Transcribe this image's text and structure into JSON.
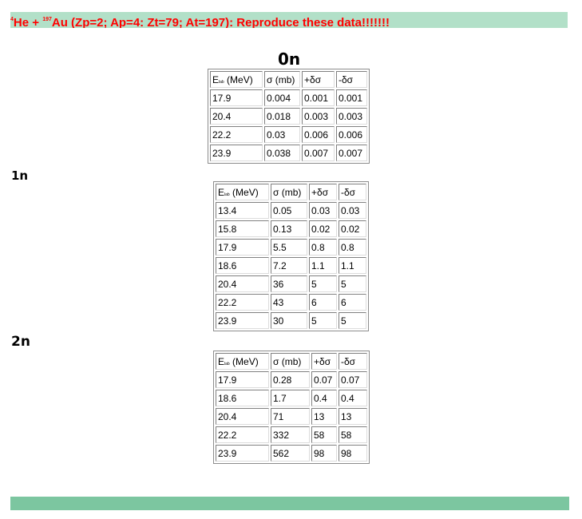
{
  "title": {
    "mass_projectile": "4",
    "projectile": "He + ",
    "mass_target": "197",
    "text": "Au (Zp=2; Ap=4: Zt=79; At=197): Reproduce these data!!!!!!!"
  },
  "header_labels": {
    "energy_main": "E",
    "energy_sub": "lab",
    "energy_unit": " (MeV)",
    "sigma": "σ (mb)",
    "plus_err": "+δσ",
    "minus_err": "-δσ"
  },
  "sections": [
    {
      "heading": "0n",
      "rows": [
        [
          "17.9",
          "0.004",
          "0.001",
          "0.001"
        ],
        [
          "20.4",
          "0.018",
          "0.003",
          "0.003"
        ],
        [
          "22.2",
          "0.03",
          "0.006",
          "0.006"
        ],
        [
          "23.9",
          "0.038",
          "0.007",
          "0.007"
        ]
      ]
    },
    {
      "heading": "1n",
      "rows": [
        [
          "13.4",
          "0.05",
          "0.03",
          "0.03"
        ],
        [
          "15.8",
          "0.13",
          "0.02",
          "0.02"
        ],
        [
          "17.9",
          "5.5",
          "0.8",
          "0.8"
        ],
        [
          "18.6",
          "7.2",
          "1.1",
          "1.1"
        ],
        [
          "20.4",
          "36",
          "5",
          "5"
        ],
        [
          "22.2",
          "43",
          "6",
          "6"
        ],
        [
          "23.9",
          "30",
          "5",
          "5"
        ]
      ]
    },
    {
      "heading": "2n",
      "rows": [
        [
          "17.9",
          "0.28",
          "0.07",
          "0.07"
        ],
        [
          "18.6",
          "1.7",
          "0.4",
          "0.4"
        ],
        [
          "20.4",
          "71",
          "13",
          "13"
        ],
        [
          "22.2",
          "332",
          "58",
          "58"
        ],
        [
          "23.9",
          "562",
          "98",
          "98"
        ]
      ]
    }
  ],
  "colors": {
    "title_bar": "#b2e0c8",
    "title_text": "#ff0000",
    "footer_bar": "#7cc6a0"
  }
}
